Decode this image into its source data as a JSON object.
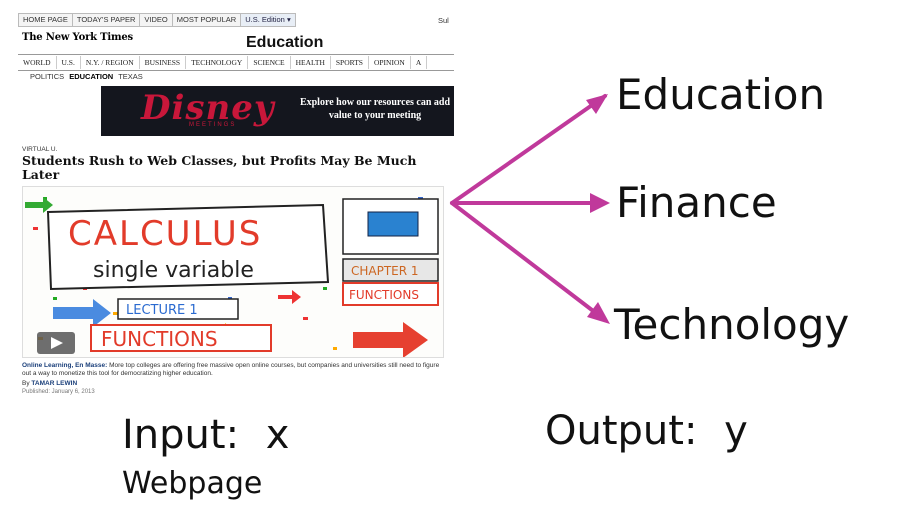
{
  "webpage": {
    "top_nav": [
      "HOME PAGE",
      "TODAY'S PAPER",
      "VIDEO",
      "MOST POPULAR"
    ],
    "edition": "U.S. Edition",
    "edition_icon": "chevron-down-icon",
    "subscribe_partial": "Sul",
    "logo": "The New York Times",
    "section_title": "Education",
    "section_nav": [
      "WORLD",
      "U.S.",
      "N.Y. / REGION",
      "BUSINESS",
      "TECHNOLOGY",
      "SCIENCE",
      "HEALTH",
      "SPORTS",
      "OPINION",
      "A"
    ],
    "sub_nav": [
      {
        "label": "POLITICS",
        "active": false
      },
      {
        "label": "EDUCATION",
        "active": true
      },
      {
        "label": "TEXAS",
        "active": false
      }
    ],
    "ad": {
      "brand": "Disney",
      "brand_sub": "MEETINGS",
      "message": "Explore how our resources can add value to your meeting"
    },
    "kicker": "VIRTUAL U.",
    "headline": "Students Rush to Web Classes, but Profits May Be Much Later",
    "image": {
      "title": "CALCULUS",
      "subtitle": "single variable",
      "chapter": "CHAPTER 1",
      "chapter_topic": "FUNCTIONS",
      "lecture": "LECTURE 1",
      "lecture_topic": "FUNCTIONS",
      "play_icon": "play-icon"
    },
    "summary_lead": "Online Learning, En Masse:",
    "summary_text": "More top colleges are offering free massive open online courses, but companies and universities still need to figure out a way to monetize this tool for democratizing higher education.",
    "byline_prefix": "By",
    "author": "TAMAR LEWIN",
    "published": "Published: January 6, 2013"
  },
  "outputs": [
    "Education",
    "Finance",
    "Technology"
  ],
  "arrow_color": "#c0399b",
  "input": {
    "label": "Input:",
    "var": "x",
    "desc": "Webpage"
  },
  "output": {
    "label": "Output:",
    "var": "y"
  }
}
